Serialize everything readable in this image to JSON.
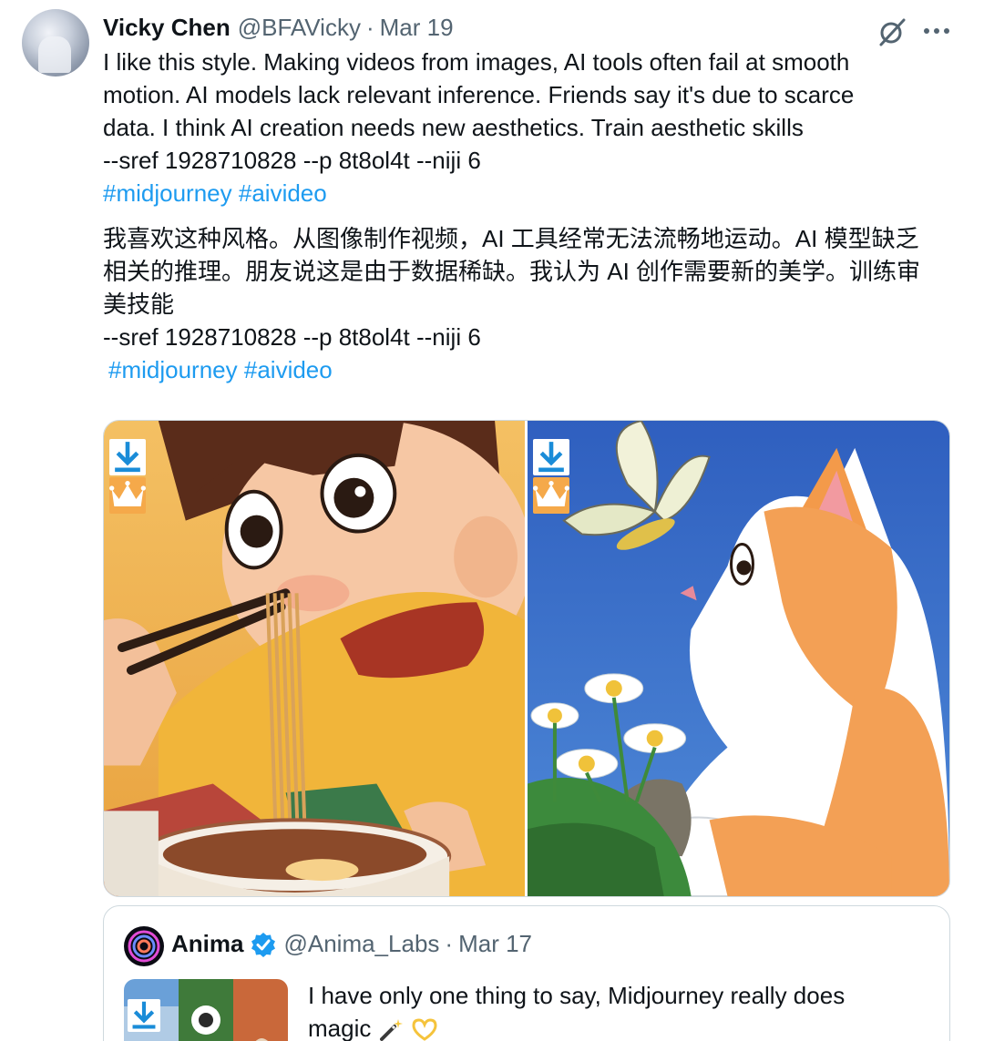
{
  "tweet": {
    "author_name": "Vicky Chen",
    "handle": "@BFAVicky",
    "separator": "·",
    "date": "Mar 19",
    "text_en_lines": [
      "I like this style. Making videos from images, AI tools often fail at smooth",
      "motion. AI models lack relevant inference. Friends say it's due to scarce",
      "data. I think AI creation needs new aesthetics. Train aesthetic skills",
      "--sref 1928710828 --p 8t8ol4t --niji 6"
    ],
    "hashtags_en": [
      "#midjourney",
      "#aivideo"
    ],
    "text_zh_lines": [
      "我喜欢这种风格。从图像制作视频，AI 工具经常无法流畅地运动。AI 模型缺乏",
      "相关的推理。朋友说这是由于数据稀缺。我认为 AI 创作需要新的美学。训练审",
      "美技能",
      "--sref 1928710828 --p 8t8ol4t --niji 6"
    ],
    "hashtags_zh": [
      "#midjourney",
      "#aivideo"
    ]
  },
  "icons": {
    "grok": "grok-icon",
    "more": "more-icon",
    "download": "download-icon",
    "crown": "crown-icon",
    "verified": "verified-badge-icon"
  },
  "colors": {
    "link": "#1d9bf0",
    "muted": "#536471",
    "text": "#0f1419",
    "border": "#cfd9de",
    "crown_bg": "#f5a94a"
  },
  "quote": {
    "name": "Anima",
    "handle": "@Anima_Labs",
    "separator": "·",
    "date": "Mar 17",
    "text_line1": "I have only one thing to say, Midjourney really does",
    "text_line2": "magic"
  }
}
